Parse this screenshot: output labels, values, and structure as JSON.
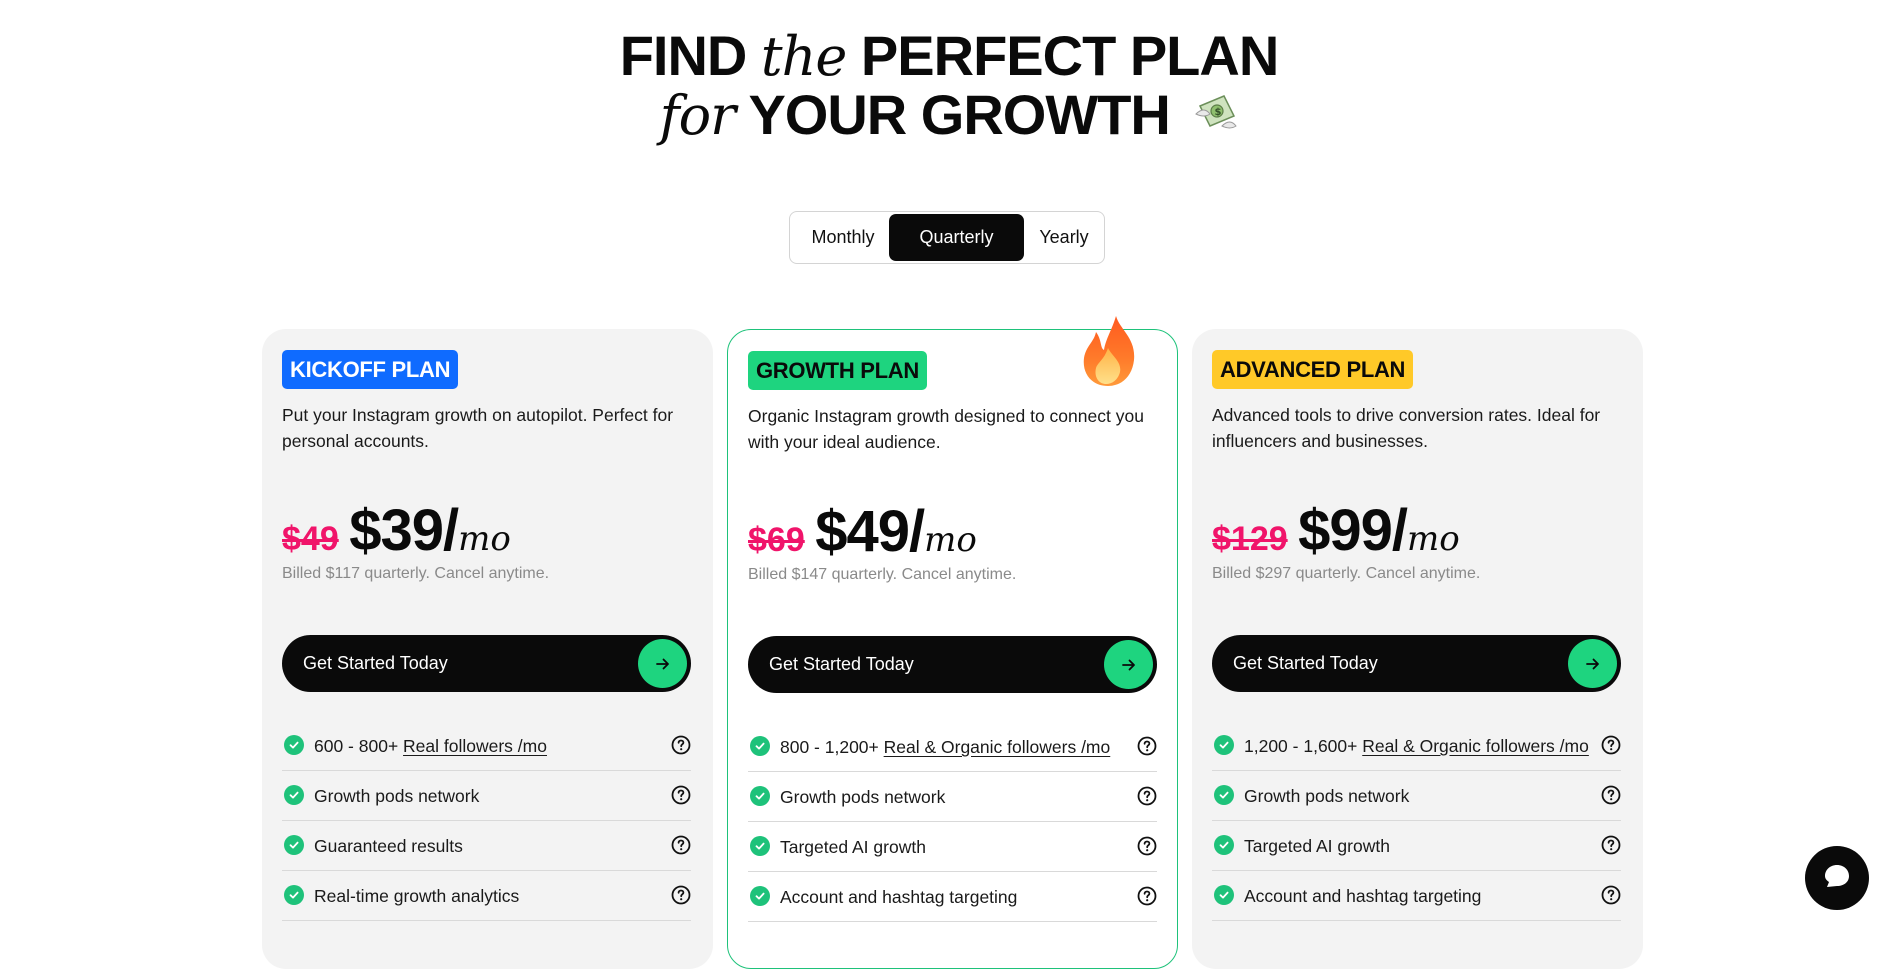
{
  "hero": {
    "w1": "FIND",
    "w2": "the",
    "w3": "PERFECT PLAN",
    "w4": "for",
    "w5": "YOUR GROWTH"
  },
  "billing_toggle": {
    "options": [
      "Monthly",
      "Quarterly",
      "Yearly"
    ],
    "selected": "Quarterly"
  },
  "plans": [
    {
      "badge": "KICKOFF PLAN",
      "badge_color": "#0f6bff",
      "badge_text_color": "#ffffff",
      "description": "Put your Instagram growth on autopilot. Perfect for personal accounts.",
      "old_price": "$49",
      "price": "$39/",
      "per": "mo",
      "billed": "Billed $117 quarterly. Cancel anytime.",
      "cta": "Get Started Today",
      "features": [
        {
          "pre": "600 - 800+ ",
          "link": "Real followers /mo"
        },
        {
          "pre": "Growth pods network",
          "link": ""
        },
        {
          "pre": "Guaranteed results",
          "link": ""
        },
        {
          "pre": "Real-time growth analytics",
          "link": ""
        }
      ]
    },
    {
      "badge": "GROWTH PLAN",
      "badge_color": "#1ed47f",
      "badge_text_color": "#0a0a0a",
      "description": "Organic Instagram growth designed to connect you with your ideal audience.",
      "old_price": "$69",
      "price": "$49/",
      "per": "mo",
      "billed": "Billed $147 quarterly. Cancel anytime.",
      "cta": "Get Started Today",
      "features": [
        {
          "pre": "800 - 1,200+ ",
          "link": "Real & Organic followers /mo"
        },
        {
          "pre": "Growth pods network",
          "link": ""
        },
        {
          "pre": "Targeted AI growth",
          "link": ""
        },
        {
          "pre": "Account and hashtag targeting",
          "link": ""
        }
      ]
    },
    {
      "badge": "ADVANCED PLAN",
      "badge_color": "#ffc928",
      "badge_text_color": "#0a0a0a",
      "description": "Advanced tools to drive conversion rates. Ideal for influencers and businesses.",
      "old_price": "$129",
      "price": "$99/",
      "per": "mo",
      "billed": "Billed $297 quarterly. Cancel anytime.",
      "cta": "Get Started Today",
      "features": [
        {
          "pre": "1,200 - 1,600+ ",
          "link": "Real & Organic followers /mo"
        },
        {
          "pre": "Growth pods network",
          "link": ""
        },
        {
          "pre": "Targeted AI growth",
          "link": ""
        },
        {
          "pre": "Account and hashtag targeting",
          "link": ""
        }
      ]
    }
  ],
  "icons": {
    "hero_emoji": "money-with-wings-icon",
    "featured": "fire-icon",
    "feature_check": "check-circle-icon",
    "feature_help": "question-circle-icon",
    "cta_arrow": "arrow-right-icon",
    "chat": "chat-bubble-icon"
  },
  "colors": {
    "accent_green": "#1ed47f",
    "strike_red": "#f0146a"
  }
}
